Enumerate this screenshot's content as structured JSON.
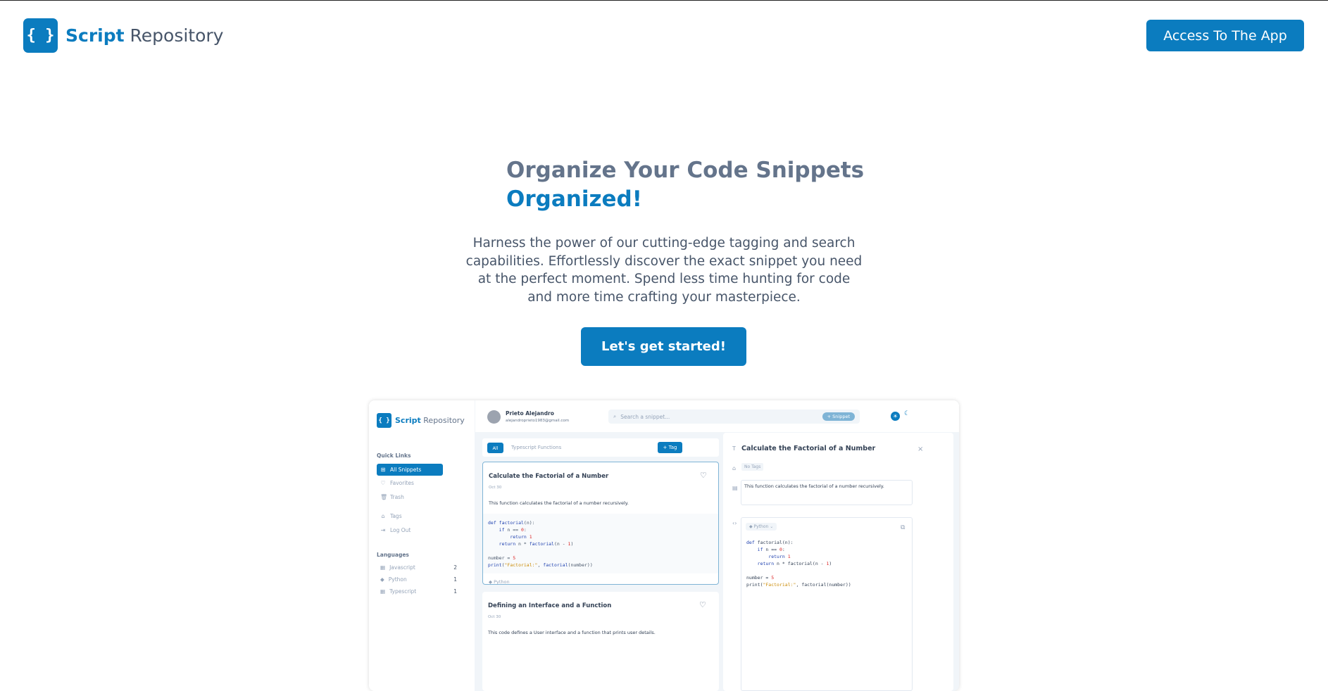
{
  "nav": {
    "brand_bold": "Script",
    "brand_rest": "Repository",
    "logo_glyph": "{ }",
    "cta": "Access To The App"
  },
  "hero": {
    "title_line1": "Organize Your Code Snippets",
    "title_line2": "Organized!",
    "description": "Harness the power of our cutting-edge tagging and search capabilities. Effortlessly discover the exact snippet you need at the perfect moment. Spend less time hunting for code and more time crafting your masterpiece.",
    "button": "Let's get started!"
  },
  "colors": {
    "accent": "#0b7cbf",
    "title_gray": "#64748b"
  },
  "preview": {
    "brand_bold": "Script",
    "brand_rest": "Repository",
    "sidebar": {
      "quick_links_title": "Quick Links",
      "items": [
        {
          "label": "All Snippets",
          "icon": "grid-icon",
          "glyph": "⊞"
        },
        {
          "label": "Favorites",
          "icon": "heart-icon",
          "glyph": "♡"
        },
        {
          "label": "Trash",
          "icon": "trash-icon",
          "glyph": "🗑"
        },
        {
          "label": "Tags",
          "icon": "tag-icon",
          "glyph": "⌂"
        },
        {
          "label": "Log Out",
          "icon": "logout-icon",
          "glyph": "⇥"
        }
      ],
      "languages_title": "Languages",
      "languages": [
        {
          "label": "Javascript",
          "count": "2",
          "glyph": "▦"
        },
        {
          "label": "Python",
          "count": "1",
          "glyph": "◆"
        },
        {
          "label": "Typescript",
          "count": "1",
          "glyph": "▦"
        }
      ]
    },
    "user": {
      "name": "Prieto Alejandro",
      "email": "alejandroprieto1983@gmail.com"
    },
    "search": {
      "placeholder": "Search a snippet...",
      "button": "+ Snippet"
    },
    "tags": {
      "all": "All",
      "other": "Typescript Functions",
      "add": "+ Tag"
    },
    "cards": [
      {
        "title": "Calculate the Factorial of a Number",
        "date": "Oct 30",
        "description": "This function calculates the factorial of a number recursively.",
        "language": "Python"
      },
      {
        "title": "Defining an Interface and a Function",
        "date": "Oct 30",
        "description": "This code defines a User interface and a function that prints user details."
      }
    ],
    "detail": {
      "title": "Calculate the Factorial of a Number",
      "tags": "No Tags",
      "description": "This function calculates the factorial of a number recursively.",
      "language": "Python"
    }
  }
}
